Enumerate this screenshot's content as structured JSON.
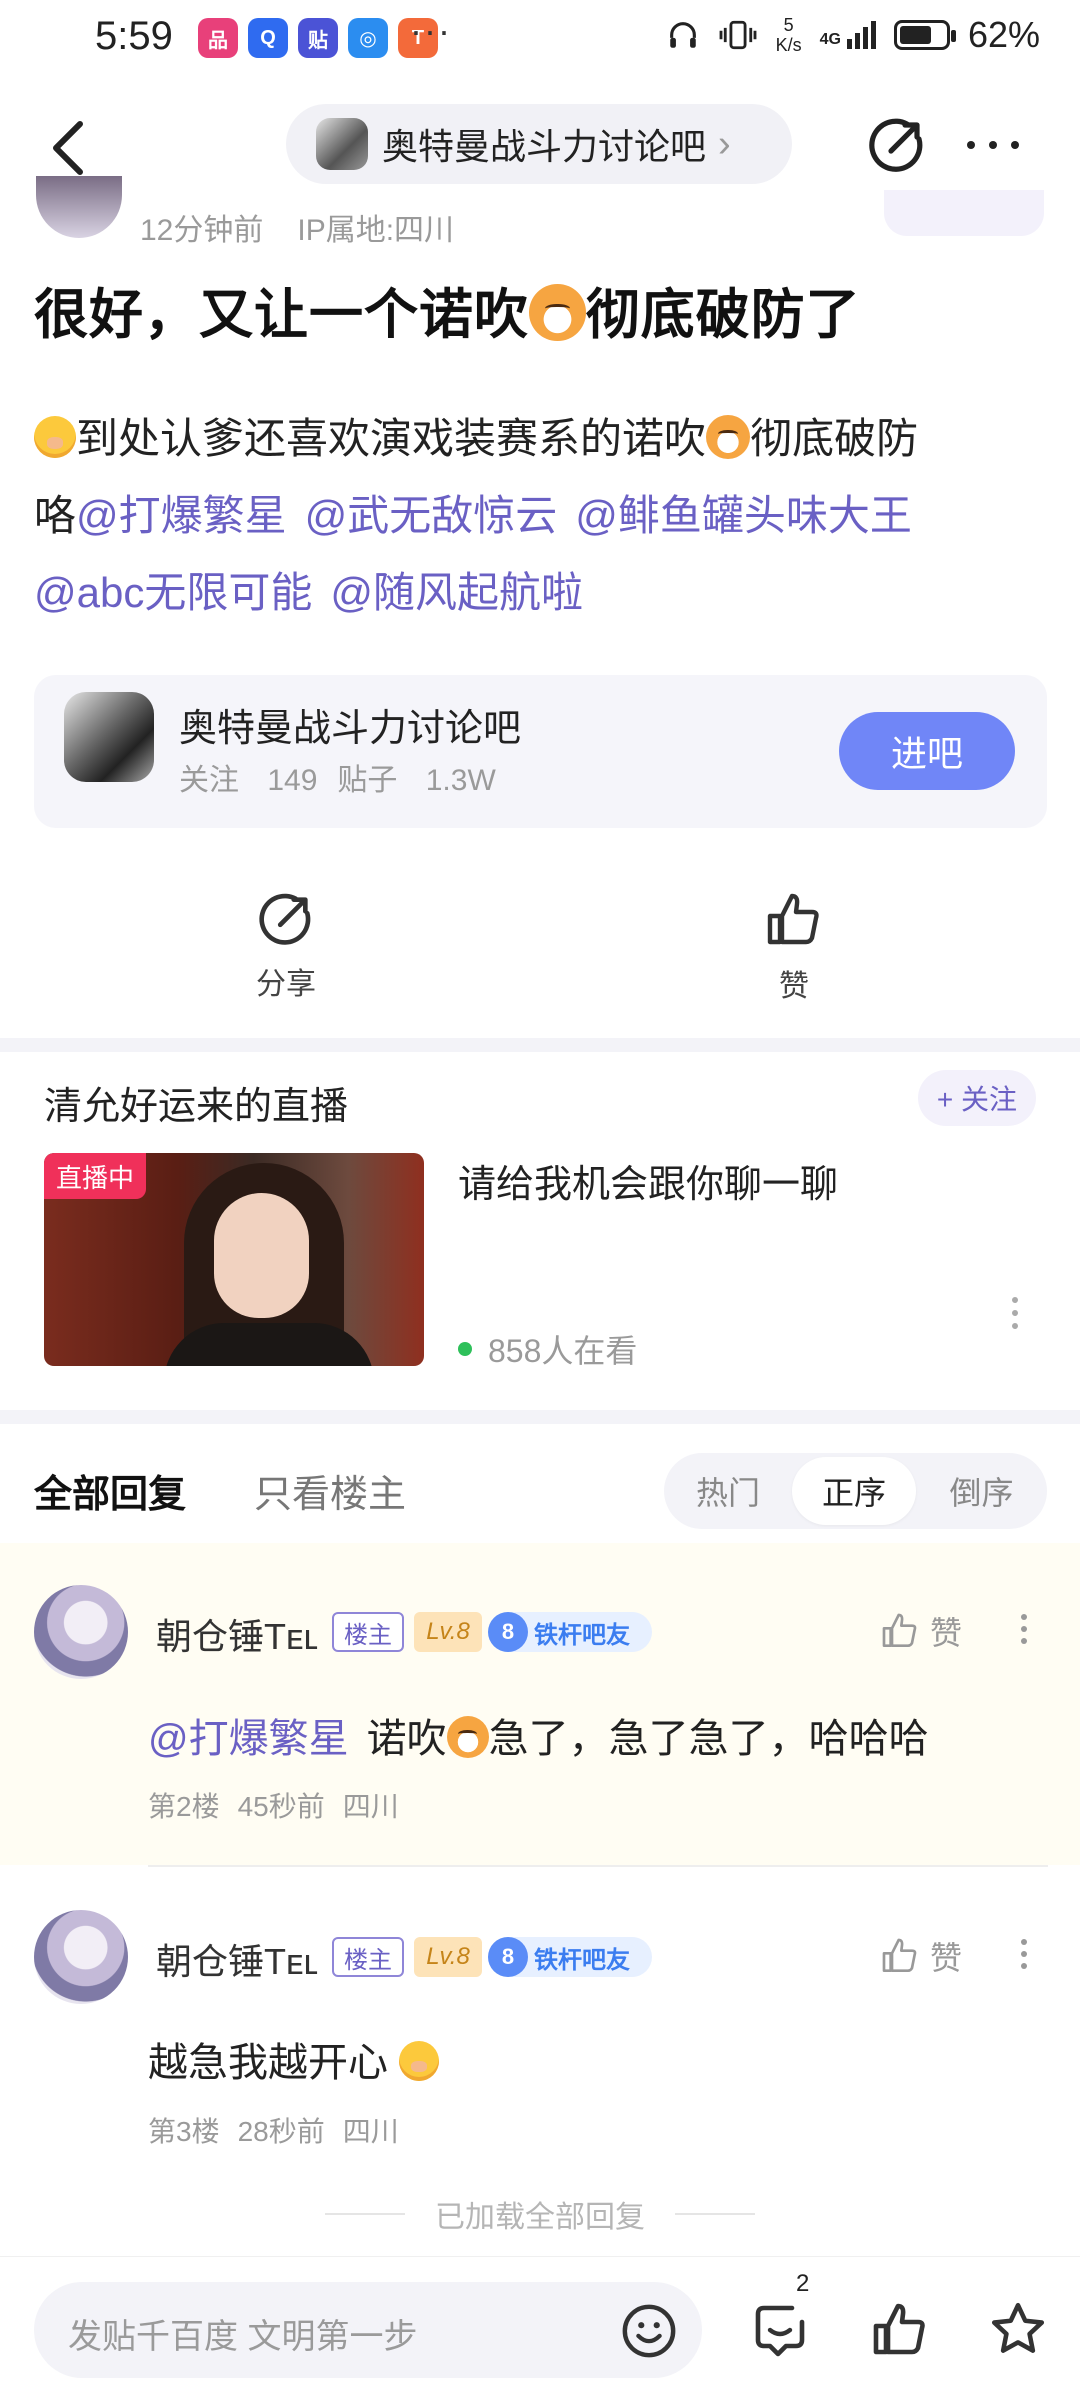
{
  "status_bar": {
    "time": "5:59",
    "dots": "···",
    "net_speed_value": "5",
    "net_speed_unit": "K/s",
    "network": "4G",
    "battery": "62%",
    "app_icons": [
      {
        "name": "app-icon-1",
        "color": "#e8407a",
        "glyph": "品"
      },
      {
        "name": "app-icon-2",
        "color": "#2f6bf0",
        "glyph": "Q"
      },
      {
        "name": "app-icon-3",
        "color": "#4b53d6",
        "glyph": "贴"
      },
      {
        "name": "app-icon-4",
        "color": "#2b8df0",
        "glyph": "◎"
      },
      {
        "name": "app-icon-5",
        "color": "#f36a3a",
        "glyph": "T"
      }
    ]
  },
  "header": {
    "forum_name": "奥特曼战斗力讨论吧",
    "chevron": "›"
  },
  "post": {
    "time_ago": "12分钟前",
    "ip_location": "IP属地:四川",
    "title_part1": "很好，又让一个诺吹",
    "title_part2": "彻底破防了",
    "body_line1_part1": "到处认爹还喜欢演戏装赛系的诺吹",
    "body_line1_part2": "彻底破防",
    "body_line2_prefix": "咯",
    "mentions": [
      "@打爆繁星",
      "@武无敌惊云",
      "@鲱鱼罐头味大王",
      "@abc无限可能",
      "@随风起航啦"
    ]
  },
  "forum_card": {
    "name": "奥特曼战斗力讨论吧",
    "follow_label": "关注",
    "follow_count": "149",
    "post_label": "贴子",
    "post_count": "1.3W",
    "enter_label": "进吧"
  },
  "actions": {
    "share_label": "分享",
    "like_label": "赞"
  },
  "live": {
    "title": "清允好运来的直播",
    "follow_label": "+ 关注",
    "badge": "直播中",
    "description": "请给我机会跟你聊一聊",
    "viewers": "858人在看"
  },
  "reply_tabs": {
    "all": "全部回复",
    "host_only": "只看楼主",
    "sort_options": [
      "热门",
      "正序",
      "倒序"
    ],
    "selected_sort": "正序"
  },
  "replies": [
    {
      "user": "朝仓锤Tᴇʟ",
      "tag_host": "楼主",
      "level": "Lv.8",
      "fan_level": "8",
      "fan_title": "铁杆吧友",
      "like_label": "赞",
      "mention": "@打爆繁星",
      "text_part1": "诺吹",
      "text_part2": "急了，急了急了，哈哈哈",
      "floor": "第2楼",
      "time": "45秒前",
      "location": "四川"
    },
    {
      "user": "朝仓锤Tᴇʟ",
      "tag_host": "楼主",
      "level": "Lv.8",
      "fan_level": "8",
      "fan_title": "铁杆吧友",
      "like_label": "赞",
      "text": "越急我越开心",
      "floor": "第3楼",
      "time": "28秒前",
      "location": "四川"
    }
  ],
  "loaded_all": "已加载全部回复",
  "bottom_bar": {
    "input_placeholder": "发贴千百度 文明第一步",
    "comment_count": "2"
  },
  "colors": {
    "accent": "#7086f7",
    "mention": "#6a60c4",
    "live_badge": "#f0305a",
    "online_dot": "#2ec05a"
  }
}
